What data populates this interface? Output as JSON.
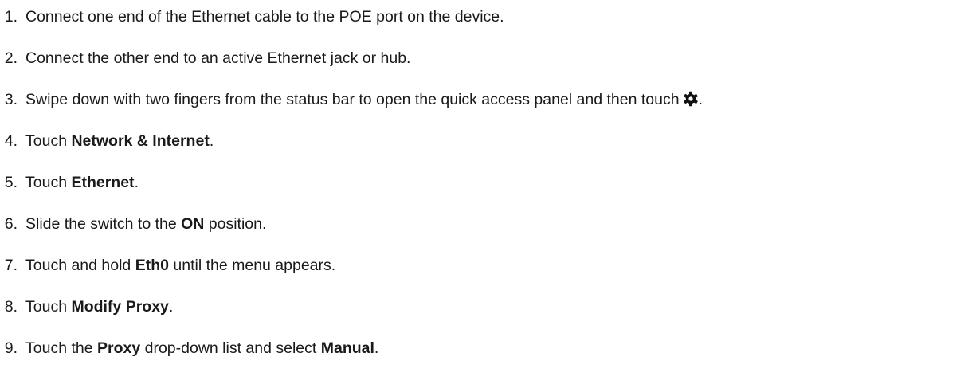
{
  "steps": [
    {
      "num": "1.",
      "text": "Connect one end of the Ethernet cable to the POE port on the device."
    },
    {
      "num": "2.",
      "text": "Connect the other end to an active Ethernet jack or hub."
    },
    {
      "num": "3.",
      "text": "Swipe down with two fingers from the status bar to open the quick access panel and then touch",
      "end": ".",
      "icon": "gear-icon"
    },
    {
      "num": "4.",
      "pre": "Touch ",
      "bold": "Network & Internet",
      "post": "."
    },
    {
      "num": "5.",
      "pre": "Touch ",
      "bold": "Ethernet",
      "post": "."
    },
    {
      "num": "6.",
      "pre": "Slide the switch to the ",
      "bold": "ON",
      "post": " position."
    },
    {
      "num": "7.",
      "pre": "Touch and hold ",
      "bold": "Eth0",
      "post": " until the menu appears."
    },
    {
      "num": "8.",
      "pre": "Touch ",
      "bold": "Modify Proxy",
      "post": "."
    },
    {
      "num": "9.",
      "pre": "Touch the ",
      "bold": "Proxy",
      "mid": " drop-down list and select ",
      "bold2": "Manual",
      "post": "."
    }
  ]
}
